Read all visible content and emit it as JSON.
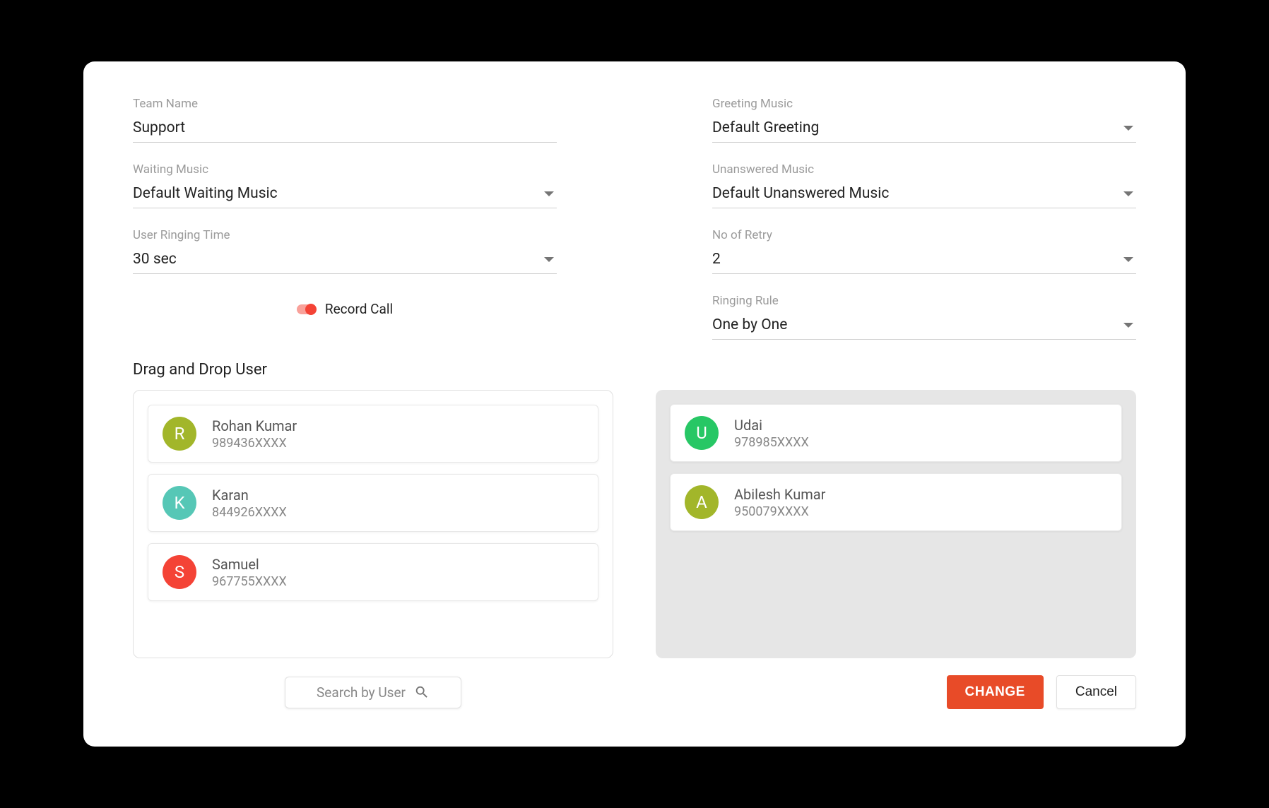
{
  "form": {
    "team_name": {
      "label": "Team Name",
      "value": "Support"
    },
    "waiting_music": {
      "label": "Waiting Music",
      "value": "Default Waiting Music"
    },
    "ringing_time": {
      "label": "User Ringing Time",
      "value": "30 sec"
    },
    "greeting_music": {
      "label": "Greeting Music",
      "value": "Default Greeting"
    },
    "unanswered_music": {
      "label": "Unanswered Music",
      "value": "Default Unanswered Music"
    },
    "no_of_retry": {
      "label": "No of Retry",
      "value": "2"
    },
    "ringing_rule": {
      "label": "Ringing Rule",
      "value": "One by One"
    },
    "record_call_label": "Record Call"
  },
  "section_title": "Drag and Drop User",
  "users_source": [
    {
      "initial": "R",
      "name": "Rohan Kumar",
      "phone": "989436XXXX",
      "color": "#a2b62a"
    },
    {
      "initial": "K",
      "name": "Karan",
      "phone": "844926XXXX",
      "color": "#56c7b6"
    },
    {
      "initial": "S",
      "name": "Samuel",
      "phone": "967755XXXX",
      "color": "#f44336"
    }
  ],
  "users_target": [
    {
      "initial": "U",
      "name": "Udai",
      "phone": "978985XXXX",
      "color": "#27c765"
    },
    {
      "initial": "A",
      "name": "Abilesh Kumar",
      "phone": "950079XXXX",
      "color": "#a2b62a"
    }
  ],
  "search_placeholder": "Search by User",
  "buttons": {
    "change": "CHANGE",
    "cancel": "Cancel"
  }
}
